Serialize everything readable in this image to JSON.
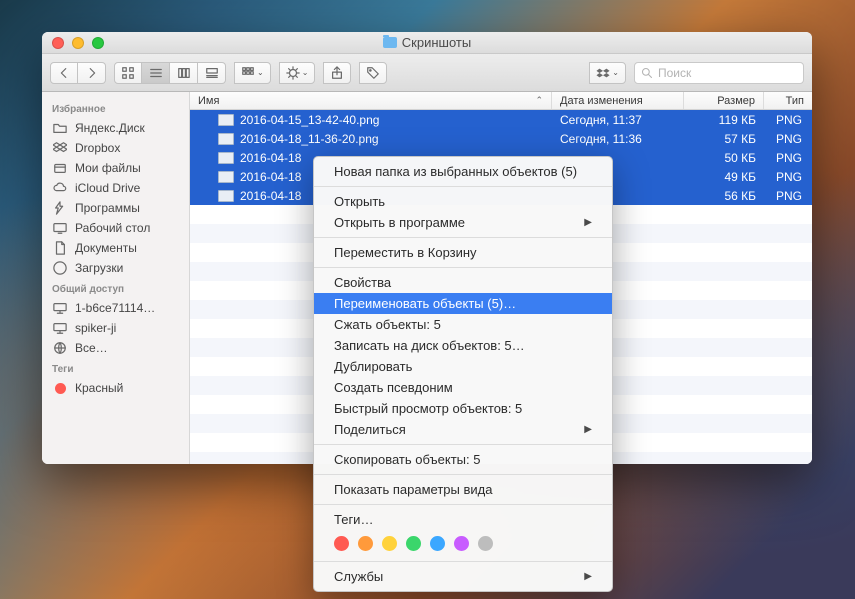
{
  "window": {
    "title": "Скриншоты"
  },
  "search": {
    "placeholder": "Поиск"
  },
  "columns": {
    "name": "Имя",
    "date": "Дата изменения",
    "size": "Размер",
    "type": "Тип"
  },
  "sidebar": {
    "sections": [
      {
        "heading": "Избранное",
        "items": [
          {
            "icon": "folder",
            "label": "Яндекс.Диск"
          },
          {
            "icon": "dropbox",
            "label": "Dropbox"
          },
          {
            "icon": "all-files",
            "label": "Мои файлы"
          },
          {
            "icon": "cloud",
            "label": "iCloud Drive"
          },
          {
            "icon": "apps",
            "label": "Программы"
          },
          {
            "icon": "desktop",
            "label": "Рабочий стол"
          },
          {
            "icon": "documents",
            "label": "Документы"
          },
          {
            "icon": "downloads",
            "label": "Загрузки"
          }
        ]
      },
      {
        "heading": "Общий доступ",
        "items": [
          {
            "icon": "computer",
            "label": "1-b6ce71114…"
          },
          {
            "icon": "computer",
            "label": "spiker-ji"
          },
          {
            "icon": "globe",
            "label": "Все…"
          }
        ]
      },
      {
        "heading": "Теги",
        "items": [
          {
            "icon": "dot",
            "label": "Красный",
            "color": "#ff5a52"
          }
        ]
      }
    ]
  },
  "files": [
    {
      "name": "2016-04-15_13-42-40.png",
      "date": "Сегодня, 11:37",
      "size": "119 КБ",
      "type": "PNG"
    },
    {
      "name": "2016-04-18_11-36-20.png",
      "date": "Сегодня, 11:36",
      "size": "57 КБ",
      "type": "PNG"
    },
    {
      "name": "2016-04-18",
      "date": "",
      "size": "50 КБ",
      "type": "PNG"
    },
    {
      "name": "2016-04-18",
      "date": "",
      "size": "49 КБ",
      "type": "PNG"
    },
    {
      "name": "2016-04-18",
      "date": "",
      "size": "56 КБ",
      "type": "PNG"
    }
  ],
  "context_menu": {
    "groups": [
      [
        {
          "label": "Новая папка из выбранных объектов (5)"
        }
      ],
      [
        {
          "label": "Открыть"
        },
        {
          "label": "Открыть в программе",
          "submenu": true
        }
      ],
      [
        {
          "label": "Переместить в Корзину"
        }
      ],
      [
        {
          "label": "Свойства"
        },
        {
          "label": "Переименовать объекты (5)…",
          "highlight": true
        },
        {
          "label": "Сжать объекты: 5"
        },
        {
          "label": "Записать на диск объектов: 5…"
        },
        {
          "label": "Дублировать"
        },
        {
          "label": "Создать псевдоним"
        },
        {
          "label": "Быстрый просмотр объектов: 5"
        },
        {
          "label": "Поделиться",
          "submenu": true
        }
      ],
      [
        {
          "label": "Скопировать объекты: 5"
        }
      ],
      [
        {
          "label": "Показать параметры вида"
        }
      ],
      [
        {
          "label": "Теги…"
        }
      ],
      [
        {
          "label": "Службы",
          "submenu": true
        }
      ]
    ],
    "tag_colors": [
      "#ff5a52",
      "#ff9a3b",
      "#ffd23b",
      "#3bd66b",
      "#3ba7ff",
      "#c85cff",
      "#bdbdbd"
    ]
  }
}
